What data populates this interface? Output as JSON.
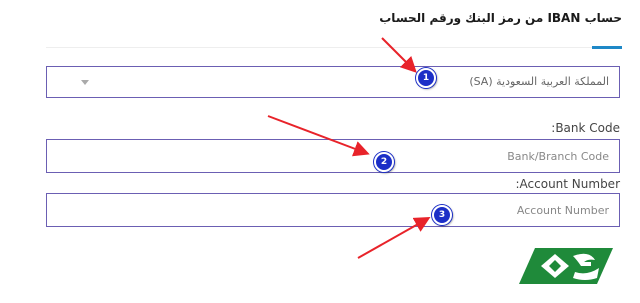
{
  "page": {
    "title": "حساب IBAN من رمز البنك ورقم الحساب"
  },
  "country_select": {
    "value": "المملكة العربية السعودية (SA)"
  },
  "bank_code": {
    "label": ":Bank Code",
    "placeholder": "Bank/Branch Code"
  },
  "account_number": {
    "label": ":Account Number",
    "placeholder": "Account Number"
  },
  "annotations": {
    "marker1": "1",
    "marker2": "2",
    "marker3": "3",
    "arrow_color": "#e8232a",
    "marker_color": "#1c2fc7"
  },
  "colors": {
    "accent": "#1e88c7",
    "field_border": "#6b5fb3",
    "logo_green": "#1f8a3a"
  },
  "logo": {
    "icon": "green-banknote-logo"
  }
}
